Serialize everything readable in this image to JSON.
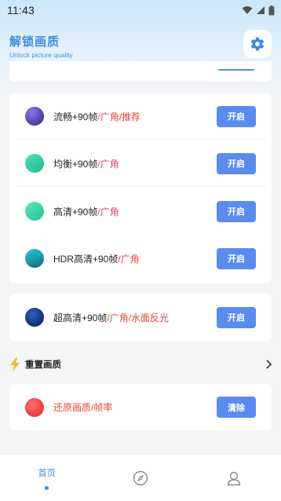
{
  "status_bar": {
    "time": "11:43"
  },
  "header": {
    "title": "解锁画质",
    "subtitle": "Unlock picture quality",
    "settings_icon": "gear-icon"
  },
  "quality_options": [
    {
      "name": "流畅+90帧",
      "tags": "/广角/推荐",
      "button": "开启",
      "icon": "purple-orb"
    },
    {
      "name": "均衡+90帧",
      "tags": "/广角",
      "button": "开启",
      "icon": "teal-orb"
    },
    {
      "name": "高清+90帧",
      "tags": "/广角",
      "button": "开启",
      "icon": "teal-orb"
    },
    {
      "name": "HDR高清+90帧",
      "tags": "/广角",
      "button": "开启",
      "icon": "hdr-orb"
    }
  ],
  "ultra_option": {
    "name": "超高清+90帧",
    "tags": "/广角/水面反光",
    "button": "开启",
    "icon": "navy-orb"
  },
  "reset_section": {
    "title": "重置画质",
    "icon": "lightning-icon",
    "item_label": "还原画质/帧率",
    "item_button": "清除"
  },
  "bottom_nav": {
    "home_label": "首页",
    "discover_icon": "compass-icon",
    "profile_icon": "person-icon"
  },
  "colors": {
    "accent": "#5a8cf0",
    "title_blue": "#3f8be0",
    "tag_red": "#e8463a"
  }
}
